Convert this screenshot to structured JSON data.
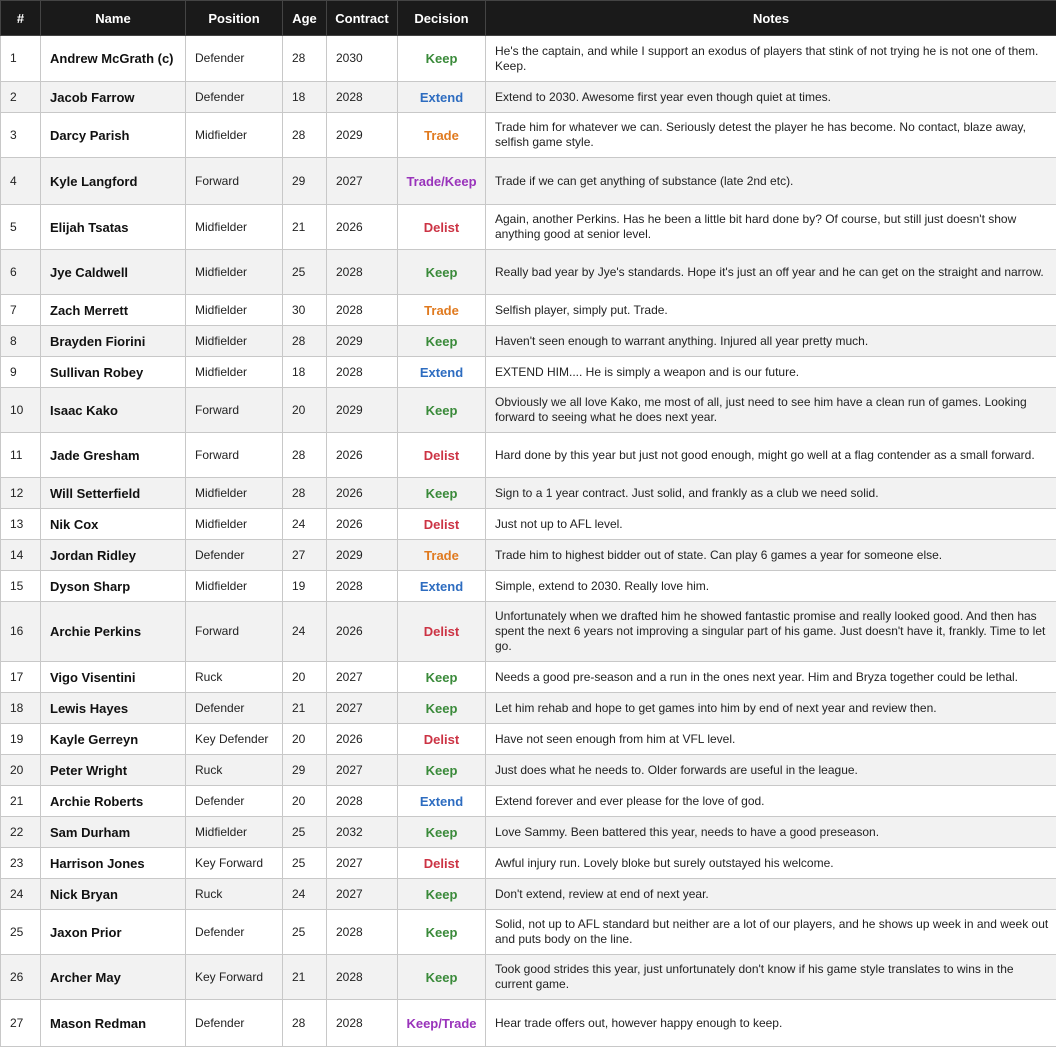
{
  "headers": [
    "#",
    "Name",
    "Position",
    "Age",
    "Contract",
    "Decision",
    "Notes"
  ],
  "decision_colors": {
    "Keep": "#3a8a3a",
    "Extend": "#2d6cc0",
    "Trade": "#e07a1f",
    "Delist": "#cc3344",
    "Trade/Keep": "#9933bb",
    "Keep/Trade": "#9933bb"
  },
  "rows": [
    {
      "num": "1",
      "name": "Andrew McGrath (c)",
      "position": "Defender",
      "age": "28",
      "contract": "2030",
      "decision": "Keep",
      "notes": "He's the captain, and while I support an exodus of players that stink of not trying he is not one of them. Keep."
    },
    {
      "num": "2",
      "name": "Jacob Farrow",
      "position": "Defender",
      "age": "18",
      "contract": "2028",
      "decision": "Extend",
      "notes": "Extend to 2030. Awesome first year even though quiet at times."
    },
    {
      "num": "3",
      "name": "Darcy Parish",
      "position": "Midfielder",
      "age": "28",
      "contract": "2029",
      "decision": "Trade",
      "notes": "Trade him for whatever we can. Seriously detest the player he has become. No contact, blaze away, selfish game style."
    },
    {
      "num": "4",
      "name": "Kyle Langford",
      "position": "Forward",
      "age": "29",
      "contract": "2027",
      "decision": "Trade/Keep",
      "notes": "Trade if we can get anything of substance (late 2nd etc)."
    },
    {
      "num": "5",
      "name": "Elijah Tsatas",
      "position": "Midfielder",
      "age": "21",
      "contract": "2026",
      "decision": "Delist",
      "notes": "Again, another Perkins. Has he been a little bit hard done by? Of course, but still just doesn't show anything good at senior level."
    },
    {
      "num": "6",
      "name": "Jye Caldwell",
      "position": "Midfielder",
      "age": "25",
      "contract": "2028",
      "decision": "Keep",
      "notes": "Really bad year by Jye's standards. Hope it's just an off year and he can get on the straight and narrow."
    },
    {
      "num": "7",
      "name": "Zach Merrett",
      "position": "Midfielder",
      "age": "30",
      "contract": "2028",
      "decision": "Trade",
      "notes": "Selfish player, simply put. Trade."
    },
    {
      "num": "8",
      "name": "Brayden Fiorini",
      "position": "Midfielder",
      "age": "28",
      "contract": "2029",
      "decision": "Keep",
      "notes": "Haven't seen enough to warrant anything. Injured all year pretty much."
    },
    {
      "num": "9",
      "name": "Sullivan Robey",
      "position": "Midfielder",
      "age": "18",
      "contract": "2028",
      "decision": "Extend",
      "notes": "EXTEND HIM.... He is simply a weapon and is our future."
    },
    {
      "num": "10",
      "name": "Isaac Kako",
      "position": "Forward",
      "age": "20",
      "contract": "2029",
      "decision": "Keep",
      "notes": "Obviously we all love Kako, me most of all, just need to see him have a clean run of games. Looking forward to seeing what he does next year."
    },
    {
      "num": "11",
      "name": "Jade Gresham",
      "position": "Forward",
      "age": "28",
      "contract": "2026",
      "decision": "Delist",
      "notes": "Hard done by this year but just not good enough, might go well at a flag contender as a small forward."
    },
    {
      "num": "12",
      "name": "Will Setterfield",
      "position": "Midfielder",
      "age": "28",
      "contract": "2026",
      "decision": "Keep",
      "notes": "Sign to a 1 year contract. Just solid, and frankly as a club we need solid."
    },
    {
      "num": "13",
      "name": "Nik Cox",
      "position": "Midfielder",
      "age": "24",
      "contract": "2026",
      "decision": "Delist",
      "notes": "Just not up to AFL level."
    },
    {
      "num": "14",
      "name": "Jordan Ridley",
      "position": "Defender",
      "age": "27",
      "contract": "2029",
      "decision": "Trade",
      "notes": "Trade him to highest bidder out of state. Can play 6 games a year for someone else."
    },
    {
      "num": "15",
      "name": "Dyson Sharp",
      "position": "Midfielder",
      "age": "19",
      "contract": "2028",
      "decision": "Extend",
      "notes": "Simple, extend to 2030. Really love him."
    },
    {
      "num": "16",
      "name": "Archie Perkins",
      "position": "Forward",
      "age": "24",
      "contract": "2026",
      "decision": "Delist",
      "notes": "Unfortunately when we drafted him he showed fantastic promise and really looked good. And then has spent the next 6 years not improving a singular part of his game. Just doesn't have it, frankly. Time to let go."
    },
    {
      "num": "17",
      "name": "Vigo Visentini",
      "position": "Ruck",
      "age": "20",
      "contract": "2027",
      "decision": "Keep",
      "notes": "Needs a good pre-season and a run in the ones next year. Him and Bryza together could be lethal."
    },
    {
      "num": "18",
      "name": "Lewis Hayes",
      "position": "Defender",
      "age": "21",
      "contract": "2027",
      "decision": "Keep",
      "notes": "Let him rehab and hope to get games into him by end of next year and review then."
    },
    {
      "num": "19",
      "name": "Kayle Gerreyn",
      "position": "Key Defender",
      "age": "20",
      "contract": "2026",
      "decision": "Delist",
      "notes": "Have not seen enough from him at VFL level."
    },
    {
      "num": "20",
      "name": "Peter Wright",
      "position": "Ruck",
      "age": "29",
      "contract": "2027",
      "decision": "Keep",
      "notes": "Just does what he needs to. Older forwards are useful in the league."
    },
    {
      "num": "21",
      "name": "Archie Roberts",
      "position": "Defender",
      "age": "20",
      "contract": "2028",
      "decision": "Extend",
      "notes": "Extend forever and ever please for the love of god."
    },
    {
      "num": "22",
      "name": "Sam Durham",
      "position": "Midfielder",
      "age": "25",
      "contract": "2032",
      "decision": "Keep",
      "notes": "Love Sammy. Been battered this year, needs to have a good preseason."
    },
    {
      "num": "23",
      "name": "Harrison Jones",
      "position": "Key Forward",
      "age": "25",
      "contract": "2027",
      "decision": "Delist",
      "notes": "Awful injury run. Lovely bloke but surely outstayed his welcome."
    },
    {
      "num": "24",
      "name": "Nick Bryan",
      "position": "Ruck",
      "age": "24",
      "contract": "2027",
      "decision": "Keep",
      "notes": "Don't extend, review at end of next year."
    },
    {
      "num": "25",
      "name": "Jaxon Prior",
      "position": "Defender",
      "age": "25",
      "contract": "2028",
      "decision": "Keep",
      "notes": "Solid, not up to AFL standard but neither are a lot of our players, and he shows up week in and week out and puts body on the line."
    },
    {
      "num": "26",
      "name": "Archer May",
      "position": "Key Forward",
      "age": "21",
      "contract": "2028",
      "decision": "Keep",
      "notes": "Took good strides this year, just unfortunately don't know if his game style translates to wins in the current game."
    },
    {
      "num": "27",
      "name": "Mason Redman",
      "position": "Defender",
      "age": "28",
      "contract": "2028",
      "decision": "Keep/Trade",
      "notes": "Hear trade offers out, however happy enough to keep."
    }
  ]
}
